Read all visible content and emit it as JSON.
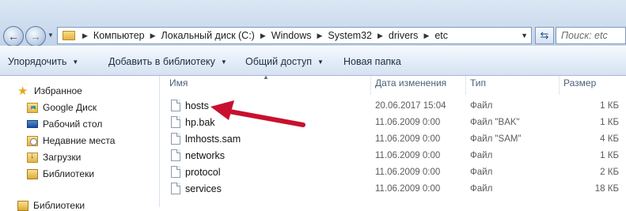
{
  "address_bar": {
    "breadcrumbs": [
      "Компьютер",
      "Локальный диск (C:)",
      "Windows",
      "System32",
      "drivers",
      "etc"
    ],
    "search_placeholder": "Поиск: etc",
    "icons": {
      "back": "back-arrow-icon",
      "forward": "forward-arrow-icon",
      "refresh": "refresh-icon",
      "folder": "folder-icon"
    }
  },
  "toolbar": {
    "organize": "Упорядочить",
    "add_to_library": "Добавить в библиотеку",
    "share": "Общий доступ",
    "new_folder": "Новая папка"
  },
  "navigation": {
    "favorites_header": "Избранное",
    "items": [
      {
        "label": "Google Диск",
        "icon": "google-drive-icon"
      },
      {
        "label": "Рабочий стол",
        "icon": "desktop-icon"
      },
      {
        "label": "Недавние места",
        "icon": "recent-places-icon"
      },
      {
        "label": "Загрузки",
        "icon": "downloads-icon"
      },
      {
        "label": "Библиотеки",
        "icon": "libraries-icon"
      }
    ],
    "libraries_header": "Библиотеки"
  },
  "file_list": {
    "columns": {
      "name": "Имя",
      "date": "Дата изменения",
      "type": "Тип",
      "size": "Размер"
    },
    "files": [
      {
        "name": "hosts",
        "date": "20.06.2017 15:04",
        "type": "Файл",
        "size": "1 КБ"
      },
      {
        "name": "hp.bak",
        "date": "11.06.2009 0:00",
        "type": "Файл \"BAK\"",
        "size": "1 КБ"
      },
      {
        "name": "lmhosts.sam",
        "date": "11.06.2009 0:00",
        "type": "Файл \"SAM\"",
        "size": "4 КБ"
      },
      {
        "name": "networks",
        "date": "11.06.2009 0:00",
        "type": "Файл",
        "size": "1 КБ"
      },
      {
        "name": "protocol",
        "date": "11.06.2009 0:00",
        "type": "Файл",
        "size": "2 КБ"
      },
      {
        "name": "services",
        "date": "11.06.2009 0:00",
        "type": "Файл",
        "size": "18 КБ"
      }
    ]
  },
  "colors": {
    "annotation_arrow": "#c8102e",
    "toolbar_text": "#1e2d45",
    "header_text": "#4c607a"
  }
}
